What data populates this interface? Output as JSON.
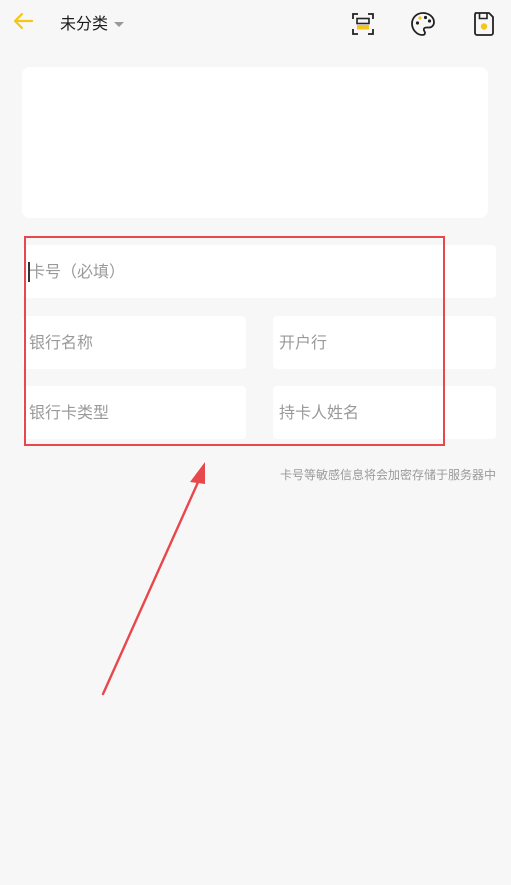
{
  "header": {
    "category": "未分类",
    "icons": [
      "back-arrow-icon",
      "scan-icon",
      "palette-icon",
      "save-icon"
    ]
  },
  "form": {
    "card_number_placeholder": "卡号（必填）",
    "bank_name_placeholder": "银行名称",
    "branch_placeholder": "开户行",
    "card_type_placeholder": "银行卡类型",
    "holder_name_placeholder": "持卡人姓名"
  },
  "hint": "卡号等敏感信息将会加密存储于服务器中",
  "colors": {
    "accent": "#f5c518",
    "annotation": "#e8474c",
    "background": "#f7f7f7",
    "placeholder": "#9a9a9a"
  }
}
